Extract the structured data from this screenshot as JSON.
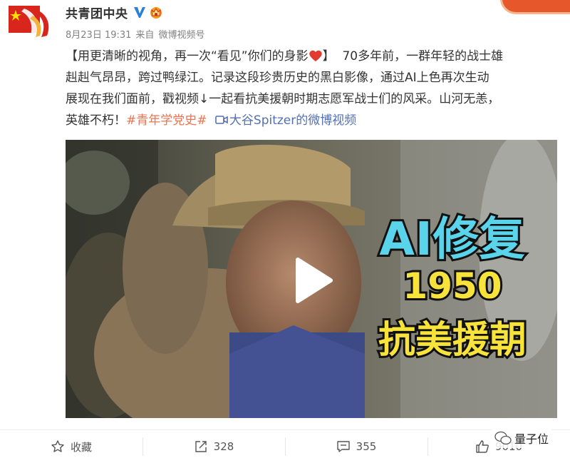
{
  "post": {
    "author": "共青团中央",
    "date": "8月23日 19:31",
    "source_prefix": "来自",
    "source": "微博视频号",
    "text": {
      "title": "【用更清晰的视角，再一次“看见”你们的身影",
      "title_end": "】",
      "line1_rest": "70多年前，一群年轻的战士雄",
      "line2": "赳赳气昂昂，跨过鸭绿江。记录这段珍贵历史的黑白影像，通过AI上色再次生动",
      "line3": "展现在我们面前，戳视频↓一起看抗美援朝时期志愿军战士们的风采。山河无恙，",
      "line4_start": "英雄不朽！",
      "hashtag": "#青年学党史#",
      "video_link": "大谷Spitzer的微博视频"
    }
  },
  "video": {
    "overlay_line1": "AI修复",
    "overlay_line2": "1950",
    "overlay_line3": "抗美援朝"
  },
  "actions": {
    "favorite": "收藏",
    "repost_count": "328",
    "comment_count": "355",
    "like_count": "9010"
  },
  "watermark": "量子位",
  "colors": {
    "link_orange": "#eb7350",
    "link_blue": "#5470b3",
    "verified": "#2a7fdb",
    "overlay_cyan": "#5ad4ea",
    "overlay_yellow": "#f7e33a"
  }
}
